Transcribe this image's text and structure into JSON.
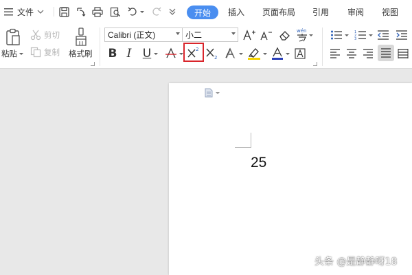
{
  "menubar": {
    "file_label": "文件",
    "tabs": [
      {
        "label": "开始"
      },
      {
        "label": "插入"
      },
      {
        "label": "页面布局"
      },
      {
        "label": "引用"
      },
      {
        "label": "审阅"
      },
      {
        "label": "视图"
      }
    ],
    "active_tab_color": "#4a8ef0"
  },
  "ribbon": {
    "clipboard": {
      "paste_label": "粘贴",
      "cut_label": "剪切",
      "copy_label": "复制",
      "format_painter_label": "格式刷"
    },
    "font": {
      "font_name": "Calibri (正文)",
      "font_size": "小二",
      "bold_glyph": "B",
      "italic_glyph": "I",
      "underline_glyph": "U",
      "superscript_highlight_color": "#d9252b"
    }
  },
  "document": {
    "text": "25"
  },
  "watermark": {
    "text": "头条 @是静静呀18"
  }
}
